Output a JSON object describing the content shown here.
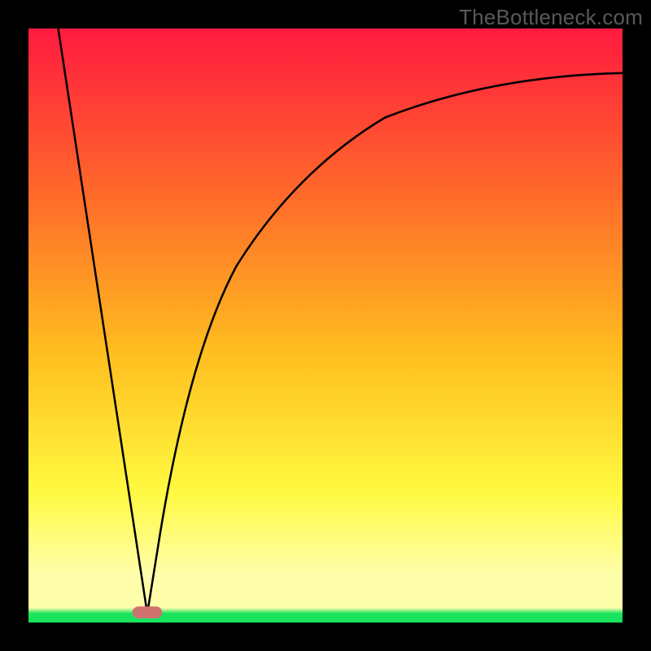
{
  "watermark": "TheBottleneck.com",
  "colors": {
    "gradient_top": "#ff1a3f",
    "gradient_mid1": "#ff6a2a",
    "gradient_mid2": "#ffbf1f",
    "gradient_mid3": "#fff940",
    "gradient_bottom_yellow": "#ffffab",
    "gradient_green": "#18e45e",
    "curve": "#000000",
    "marker": "#d0726f"
  },
  "chart_data": {
    "type": "line",
    "title": "",
    "xlabel": "",
    "ylabel": "",
    "xlim": [
      0,
      100
    ],
    "ylim": [
      0,
      100
    ],
    "minimum_x": 20,
    "left_branch": {
      "description": "straight line from upper-left (x≈5, y≈100) to minimum (x≈20, y≈0)",
      "start": {
        "x": 5,
        "y": 100
      },
      "end": {
        "x": 20,
        "y": 0
      }
    },
    "right_branch": {
      "description": "concave curve rising fast then flattening asymptotically",
      "x": [
        20,
        23,
        26,
        30,
        35,
        40,
        48,
        58,
        70,
        85,
        100
      ],
      "y": [
        0,
        15,
        30,
        45,
        58,
        67,
        76,
        83,
        88,
        91,
        92
      ]
    },
    "marker": {
      "description": "small rounded red-pink lozenge at the curve minimum near baseline",
      "x": 20,
      "y": 1,
      "rx": 3,
      "ry": 1.2
    }
  }
}
